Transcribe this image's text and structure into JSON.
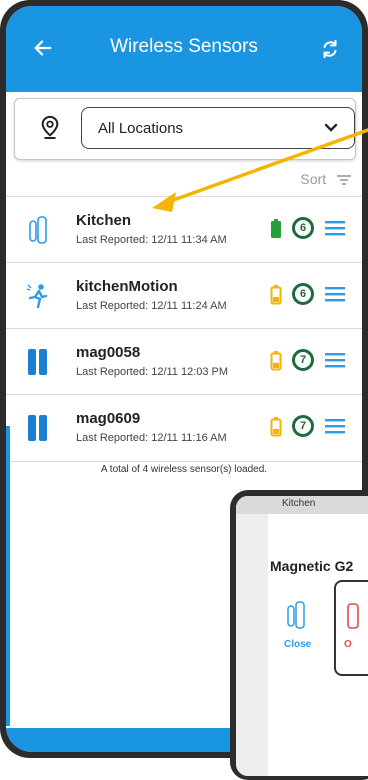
{
  "header": {
    "title": "Wireless Sensors",
    "back_icon": "arrow-left-icon",
    "refresh_icon": "refresh-icon"
  },
  "filter": {
    "location_value": "All Locations"
  },
  "sort_label": "Sort",
  "sensors": [
    {
      "name": "Kitchen",
      "last_reported": "Last Reported: 12/11 11:34 AM",
      "battery_color": "#2a9d3b",
      "level": "6",
      "icon": "door-sensor-icon"
    },
    {
      "name": "kitchenMotion",
      "last_reported": "Last Reported: 12/11 11:24 AM",
      "battery_color": "#f5b400",
      "level": "6",
      "icon": "motion-sensor-icon"
    },
    {
      "name": "mag0058",
      "last_reported": "Last Reported: 12/11 12:03 PM",
      "battery_color": "#f5b400",
      "level": "7",
      "icon": "magnetic-sensor-icon"
    },
    {
      "name": "mag0609",
      "last_reported": "Last Reported: 12/11 11:16 AM",
      "battery_color": "#f5b400",
      "level": "7",
      "icon": "magnetic-sensor-icon"
    }
  ],
  "footer": "A total of 4 wireless sensor(s) loaded.",
  "popup": {
    "header_label": "Kitchen",
    "title": "Magnetic G2",
    "close_label": "Close",
    "open_label": "O"
  },
  "colors": {
    "accent": "#1a95e1",
    "arrow": "#f5b400"
  }
}
